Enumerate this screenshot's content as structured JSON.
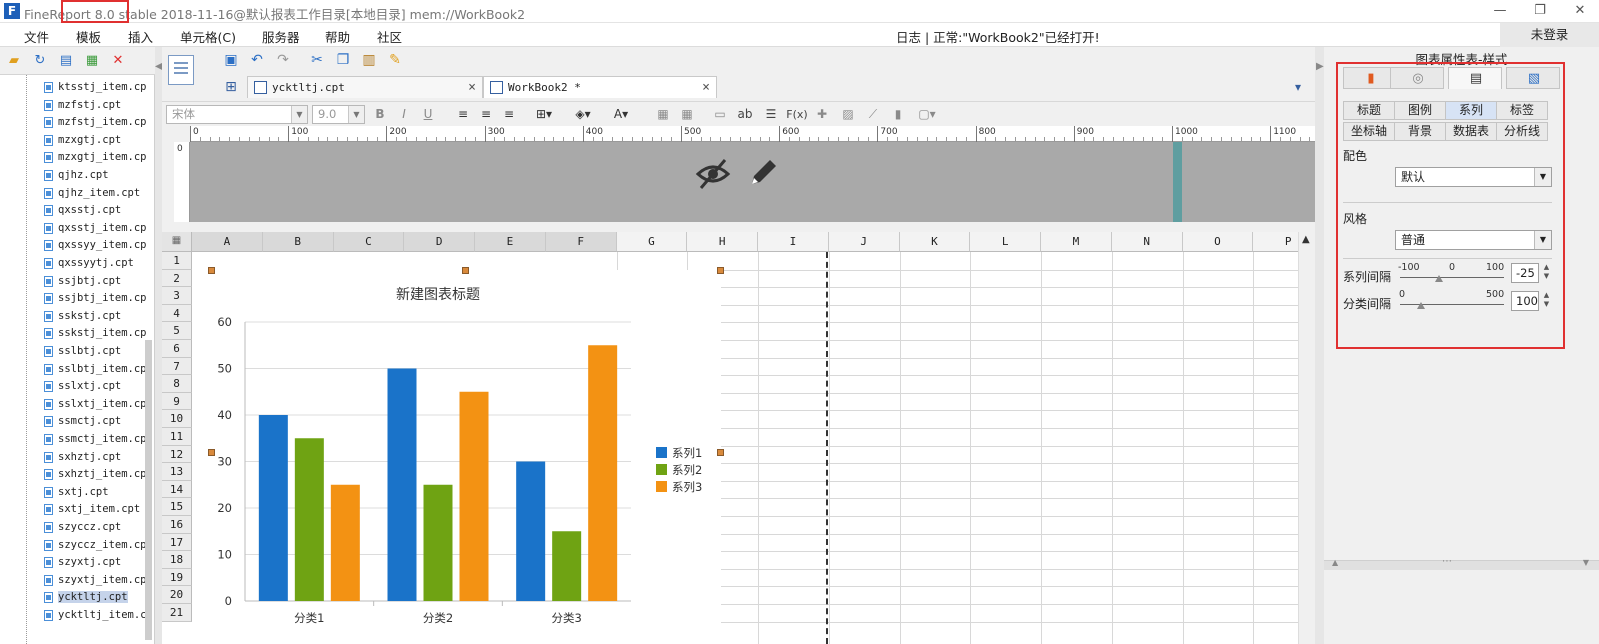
{
  "titlebar": {
    "title": "FineReport 8.0 stable 2018-11-16@默认报表工作目录[本地目录]     mem://WorkBook2",
    "minimize": "—",
    "restore": "❐",
    "close": "✕"
  },
  "menubar": {
    "items": [
      "文件",
      "模板",
      "插入",
      "单元格(C)",
      "服务器",
      "帮助",
      "社区"
    ],
    "log_text": "日志  |  正常:\"WorkBook2\"已经打开!",
    "login": "未登录"
  },
  "tree": {
    "items": [
      "ktsstj_item.cp",
      "mzfstj.cpt",
      "mzfstj_item.cp",
      "mzxgtj.cpt",
      "mzxgtj_item.cp",
      "qjhz.cpt",
      "qjhz_item.cpt",
      "qxsstj.cpt",
      "qxsstj_item.cp",
      "qxssyy_item.cp",
      "qxssyytj.cpt",
      "ssjbtj.cpt",
      "ssjbtj_item.cp",
      "sskstj.cpt",
      "sskstj_item.cp",
      "sslbtj.cpt",
      "sslbtj_item.cp",
      "sslxtj.cpt",
      "sslxtj_item.cp",
      "ssmctj.cpt",
      "ssmctj_item.cp",
      "sxhztj.cpt",
      "sxhztj_item.cp",
      "sxtj.cpt",
      "sxtj_item.cpt",
      "szyccz.cpt",
      "szyccz_item.cp",
      "szyxtj.cpt",
      "szyxtj_item.cp",
      "ycktltj.cpt",
      "ycktltj_item.cp"
    ],
    "selected_index": 29
  },
  "tabs": [
    {
      "label": "ycktltj.cpt",
      "close": "×"
    },
    {
      "label": "WorkBook2 *",
      "close": "×"
    }
  ],
  "format": {
    "font_name": "宋体",
    "font_size": "9.0",
    "bold": "B",
    "italic": "I",
    "underline": "U",
    "text_btn": "ab",
    "fx": "F(x)"
  },
  "ruler": {
    "labels": [
      "0",
      "100",
      "200",
      "300",
      "400",
      "500",
      "600",
      "700",
      "800",
      "900",
      "1000",
      "1100"
    ],
    "v_label": "0"
  },
  "sheet": {
    "columns": [
      "A",
      "B",
      "C",
      "D",
      "E",
      "F",
      "G",
      "H",
      "I",
      "J",
      "K",
      "L",
      "M",
      "N",
      "O",
      "P"
    ],
    "rows": [
      "1",
      "2",
      "3",
      "4",
      "5",
      "6",
      "7",
      "8",
      "9",
      "10",
      "11",
      "12",
      "13",
      "14",
      "15",
      "16",
      "17",
      "18",
      "19",
      "20",
      "21"
    ],
    "corner": "▦"
  },
  "chart_data": {
    "type": "bar",
    "title": "新建图表标题",
    "categories": [
      "分类1",
      "分类2",
      "分类3"
    ],
    "series": [
      {
        "name": "系列1",
        "values": [
          40,
          50,
          30
        ],
        "color": "#1a73c9"
      },
      {
        "name": "系列2",
        "values": [
          35,
          25,
          15
        ],
        "color": "#6fa313"
      },
      {
        "name": "系列3",
        "values": [
          25,
          45,
          55
        ],
        "color": "#f39213"
      }
    ],
    "ylim": [
      0,
      60
    ],
    "yticks": [
      "0",
      "10",
      "20",
      "30",
      "40",
      "50",
      "60"
    ],
    "grid": true,
    "legend_position": "right"
  },
  "panel": {
    "title": "图表属性表-样式",
    "tabs_row1": [
      "标题",
      "图例",
      "系列",
      "标签"
    ],
    "tabs_row2": [
      "坐标轴",
      "背景",
      "数据表",
      "分析线"
    ],
    "active_tab": "系列",
    "color_label": "配色",
    "color_value": "默认",
    "style_label": "风格",
    "style_value": "普通",
    "series_gap_label": "系列间隔",
    "series_gap_min": "-100",
    "series_gap_mid": "0",
    "series_gap_max": "100",
    "series_gap_value": "-25",
    "series_gap_fraction": 0.375,
    "cat_gap_label": "分类间隔",
    "cat_gap_min": "0",
    "cat_gap_max": "500",
    "cat_gap_value": "100",
    "cat_gap_fraction": 0.2
  },
  "colors": {
    "accent": "#2c6fc5",
    "highlight": "#e03030",
    "teal": "#5f9ea0"
  }
}
